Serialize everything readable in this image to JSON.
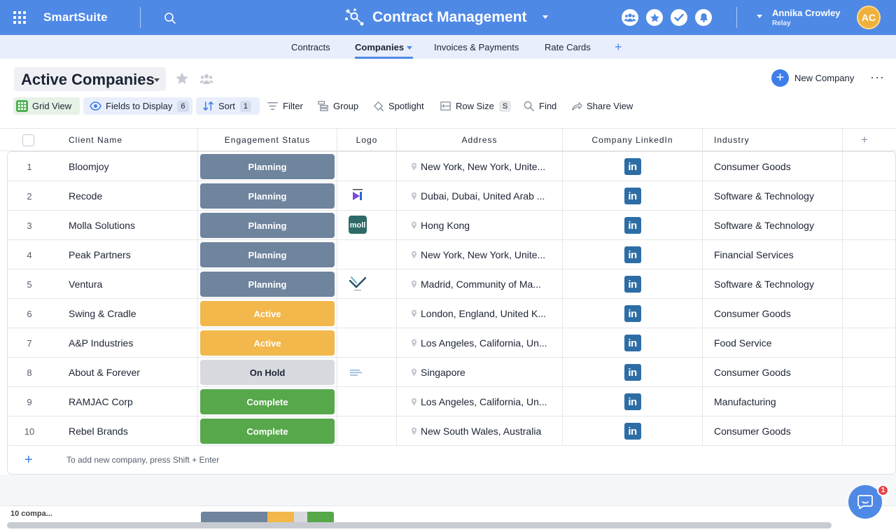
{
  "topbar": {
    "brand": "SmartSuite",
    "app_title": "Contract Management",
    "user_name": "Annika Crowley",
    "user_org": "Relay",
    "avatar_initials": "AC",
    "color": "#4f89e6"
  },
  "subnav": {
    "tabs": [
      {
        "label": "Contracts"
      },
      {
        "label": "Companies",
        "active": true
      },
      {
        "label": "Invoices & Payments"
      },
      {
        "label": "Rate Cards"
      }
    ],
    "add_label": "+"
  },
  "view": {
    "title": "Active Companies",
    "new_button": "New Company",
    "more": "···"
  },
  "toolbar": {
    "grid_view": "Grid View",
    "fields": "Fields to Display",
    "fields_count": "6",
    "sort": "Sort",
    "sort_count": "1",
    "filter": "Filter",
    "group": "Group",
    "spotlight": "Spotlight",
    "row_size": "Row Size",
    "row_size_value": "S",
    "find": "Find",
    "share": "Share View"
  },
  "columns": {
    "client_name": "Client Name",
    "engagement_status": "Engagement Status",
    "logo": "Logo",
    "address": "Address",
    "linkedin": "Company LinkedIn",
    "industry": "Industry",
    "add": "+"
  },
  "status_colors": {
    "Planning": "#6f849d",
    "Active": "#f2b84b",
    "On Hold": "#d8dadf",
    "Complete": "#56a84a"
  },
  "rows": [
    {
      "num": "1",
      "name": "Bloomjoy",
      "status": "Planning",
      "logo": "",
      "address": "New York, New York, Unite...",
      "linkedin": "in",
      "industry": "Consumer Goods"
    },
    {
      "num": "2",
      "name": "Recode",
      "status": "Planning",
      "logo": "recode-logo",
      "address": "Dubai, Dubai, United Arab ...",
      "linkedin": "in",
      "industry": "Software & Technology"
    },
    {
      "num": "3",
      "name": "Molla Solutions",
      "status": "Planning",
      "logo": "molla-logo",
      "address": "Hong Kong",
      "linkedin": "in",
      "industry": "Software & Technology"
    },
    {
      "num": "4",
      "name": "Peak Partners",
      "status": "Planning",
      "logo": "",
      "address": "New York, New York, Unite...",
      "linkedin": "in",
      "industry": "Financial Services"
    },
    {
      "num": "5",
      "name": "Ventura",
      "status": "Planning",
      "logo": "ventura-logo",
      "address": "Madrid, Community of Ma...",
      "linkedin": "in",
      "industry": "Software & Technology"
    },
    {
      "num": "6",
      "name": "Swing & Cradle",
      "status": "Active",
      "logo": "",
      "address": "London, England, United K...",
      "linkedin": "in",
      "industry": "Consumer Goods"
    },
    {
      "num": "7",
      "name": "A&P Industries",
      "status": "Active",
      "logo": "",
      "address": "Los Angeles, California, Un...",
      "linkedin": "in",
      "industry": "Food Service"
    },
    {
      "num": "8",
      "name": "About & Forever",
      "status": "On Hold",
      "logo": "about-forever-logo",
      "address": "Singapore",
      "linkedin": "in",
      "industry": "Consumer Goods"
    },
    {
      "num": "9",
      "name": "RAMJAC Corp",
      "status": "Complete",
      "logo": "",
      "address": "Los Angeles, California, Un...",
      "linkedin": "in",
      "industry": "Manufacturing"
    },
    {
      "num": "10",
      "name": "Rebel Brands",
      "status": "Complete",
      "logo": "",
      "address": "New South Wales, Australia",
      "linkedin": "in",
      "industry": "Consumer Goods"
    }
  ],
  "add_row_hint": "To add new company, press Shift + Enter",
  "footer": {
    "count": "10 compa...",
    "status_summary": [
      {
        "status": "Planning",
        "fraction": 0.5
      },
      {
        "status": "Active",
        "fraction": 0.2
      },
      {
        "status": "On Hold",
        "fraction": 0.1
      },
      {
        "status": "Complete",
        "fraction": 0.2
      }
    ]
  },
  "chat": {
    "badge": "1"
  }
}
